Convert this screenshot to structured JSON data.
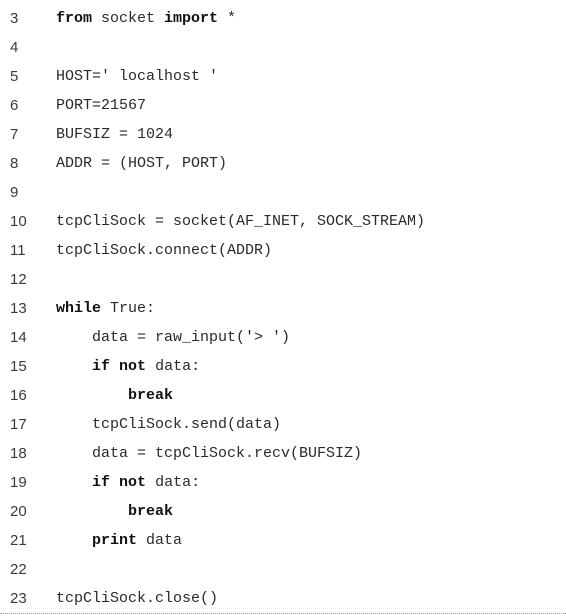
{
  "code": {
    "lines": [
      {
        "number": "3",
        "tokens": [
          {
            "t": "from",
            "kw": true
          },
          {
            "t": " socket "
          },
          {
            "t": "import",
            "kw": true
          },
          {
            "t": " *"
          }
        ]
      },
      {
        "number": "4",
        "tokens": []
      },
      {
        "number": "5",
        "tokens": [
          {
            "t": "HOST=' localhost '"
          }
        ]
      },
      {
        "number": "6",
        "tokens": [
          {
            "t": "PORT=21567"
          }
        ]
      },
      {
        "number": "7",
        "tokens": [
          {
            "t": "BUFSIZ = 1024"
          }
        ]
      },
      {
        "number": "8",
        "tokens": [
          {
            "t": "ADDR = (HOST, PORT)"
          }
        ]
      },
      {
        "number": "9",
        "tokens": []
      },
      {
        "number": "10",
        "tokens": [
          {
            "t": "tcpCliSock = socket(AF_INET, SOCK_STREAM)"
          }
        ]
      },
      {
        "number": "11",
        "tokens": [
          {
            "t": "tcpCliSock.connect(ADDR)"
          }
        ]
      },
      {
        "number": "12",
        "tokens": []
      },
      {
        "number": "13",
        "tokens": [
          {
            "t": "while",
            "kw": true
          },
          {
            "t": " True:"
          }
        ]
      },
      {
        "number": "14",
        "tokens": [
          {
            "t": "    data = raw_input('> ')"
          }
        ]
      },
      {
        "number": "15",
        "tokens": [
          {
            "t": "    "
          },
          {
            "t": "if",
            "kw": true
          },
          {
            "t": " "
          },
          {
            "t": "not",
            "kw": true
          },
          {
            "t": " data:"
          }
        ]
      },
      {
        "number": "16",
        "tokens": [
          {
            "t": "        "
          },
          {
            "t": "break",
            "kw": true
          }
        ]
      },
      {
        "number": "17",
        "tokens": [
          {
            "t": "    tcpCliSock.send(data)"
          }
        ]
      },
      {
        "number": "18",
        "tokens": [
          {
            "t": "    data = tcpCliSock.recv(BUFSIZ)"
          }
        ]
      },
      {
        "number": "19",
        "tokens": [
          {
            "t": "    "
          },
          {
            "t": "if",
            "kw": true
          },
          {
            "t": " "
          },
          {
            "t": "not",
            "kw": true
          },
          {
            "t": " data:"
          }
        ]
      },
      {
        "number": "20",
        "tokens": [
          {
            "t": "        "
          },
          {
            "t": "break",
            "kw": true
          }
        ]
      },
      {
        "number": "21",
        "tokens": [
          {
            "t": "    "
          },
          {
            "t": "print",
            "kw": true
          },
          {
            "t": " data"
          }
        ]
      },
      {
        "number": "22",
        "tokens": []
      },
      {
        "number": "23",
        "tokens": [
          {
            "t": "tcpCliSock.close()"
          }
        ]
      }
    ]
  }
}
